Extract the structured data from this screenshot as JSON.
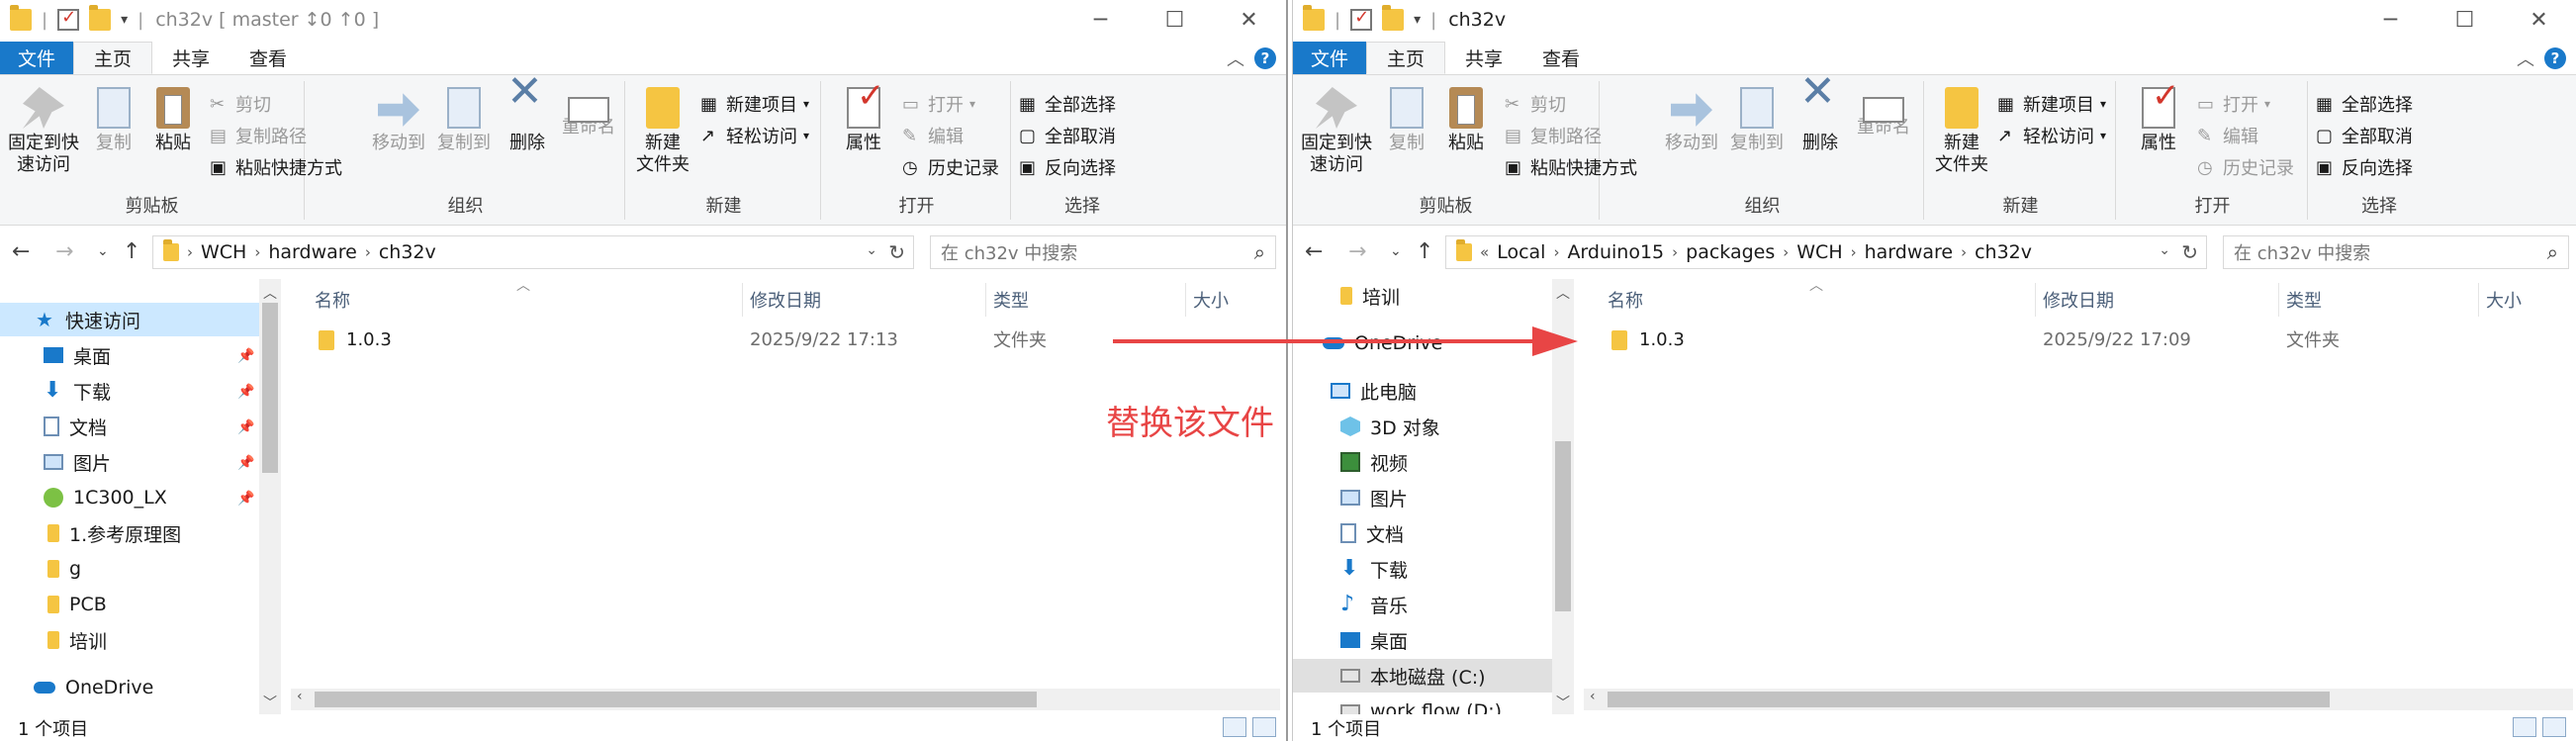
{
  "left": {
    "title": "ch32v [ master ↕0 ↑0 ]",
    "menu": {
      "file": "文件",
      "home": "主页",
      "share": "共享",
      "view": "查看"
    },
    "ribbon": {
      "pin": "固定到快\n速访问",
      "copy": "复制",
      "paste": "粘贴",
      "cut": "剪切",
      "copy_path": "复制路径",
      "paste_shortcut": "粘贴快捷方式",
      "move_to": "移动到",
      "copy_to": "复制到",
      "delete": "删除",
      "rename": "重命名",
      "new_folder": "新建\n文件夹",
      "new_item": "新建项目",
      "easy_access": "轻松访问",
      "properties": "属性",
      "open": "打开",
      "edit": "编辑",
      "history": "历史记录",
      "select_all": "全部选择",
      "select_none": "全部取消",
      "invert": "反向选择",
      "groups": {
        "clipboard": "剪贴板",
        "organize": "组织",
        "new": "新建",
        "open": "打开",
        "select": "选择"
      }
    },
    "path": [
      "WCH",
      "hardware",
      "ch32v"
    ],
    "search_placeholder": "在 ch32v 中搜索",
    "nav": [
      {
        "label": "快速访问",
        "icon": "star-icon"
      },
      {
        "label": "桌面",
        "icon": "desktop-icon"
      },
      {
        "label": "下载",
        "icon": "download-icon"
      },
      {
        "label": "文档",
        "icon": "document-icon"
      },
      {
        "label": "图片",
        "icon": "pictures-icon"
      },
      {
        "label": "1C300_LX",
        "icon": "network-folder-icon"
      },
      {
        "label": "1.参考原理图",
        "icon": "folder-icon"
      },
      {
        "label": "g",
        "icon": "folder-icon"
      },
      {
        "label": "PCB",
        "icon": "folder-icon"
      },
      {
        "label": "培训",
        "icon": "folder-icon"
      },
      {
        "label": "OneDrive",
        "icon": "onedrive-icon"
      }
    ],
    "columns": {
      "name": "名称",
      "date": "修改日期",
      "type": "类型",
      "size": "大小"
    },
    "rows": [
      {
        "name": "1.0.3",
        "date": "2025/9/22 17:13",
        "type": "文件夹"
      }
    ],
    "status": "1 个项目"
  },
  "right": {
    "title": "ch32v",
    "menu": {
      "file": "文件",
      "home": "主页",
      "share": "共享",
      "view": "查看"
    },
    "ribbon": {
      "pin": "固定到快\n速访问",
      "copy": "复制",
      "paste": "粘贴",
      "cut": "剪切",
      "copy_path": "复制路径",
      "paste_shortcut": "粘贴快捷方式",
      "move_to": "移动到",
      "copy_to": "复制到",
      "delete": "删除",
      "rename": "重命名",
      "new_folder": "新建\n文件夹",
      "new_item": "新建项目",
      "easy_access": "轻松访问",
      "properties": "属性",
      "open": "打开",
      "edit": "编辑",
      "history": "历史记录",
      "select_all": "全部选择",
      "select_none": "全部取消",
      "invert": "反向选择",
      "groups": {
        "clipboard": "剪贴板",
        "organize": "组织",
        "new": "新建",
        "open": "打开",
        "select": "选择"
      }
    },
    "path_prefix": "«",
    "path": [
      "Local",
      "Arduino15",
      "packages",
      "WCH",
      "hardware",
      "ch32v"
    ],
    "search_placeholder": "在 ch32v 中搜索",
    "nav": [
      {
        "label": "培训",
        "icon": "folder-icon"
      },
      {
        "label": "OneDrive",
        "icon": "onedrive-icon"
      },
      {
        "label": "此电脑",
        "icon": "pc-icon"
      },
      {
        "label": "3D 对象",
        "icon": "3d-objects-icon"
      },
      {
        "label": "视频",
        "icon": "video-icon"
      },
      {
        "label": "图片",
        "icon": "pictures-icon"
      },
      {
        "label": "文档",
        "icon": "document-icon"
      },
      {
        "label": "下载",
        "icon": "download-icon"
      },
      {
        "label": "音乐",
        "icon": "music-icon"
      },
      {
        "label": "桌面",
        "icon": "desktop-icon"
      },
      {
        "label": "本地磁盘 (C:)",
        "icon": "drive-icon"
      },
      {
        "label": "work flow (D:)",
        "icon": "drive-icon"
      }
    ],
    "columns": {
      "name": "名称",
      "date": "修改日期",
      "type": "类型",
      "size": "大小"
    },
    "rows": [
      {
        "name": "1.0.3",
        "date": "2025/9/22 17:09",
        "type": "文件夹"
      }
    ],
    "status": "1 个项目"
  },
  "annotation": {
    "text": "替换该文件",
    "color": "#e84545"
  },
  "colors": {
    "accent": "#1979ca",
    "folder": "#f5c542",
    "selection": "#cce8ff"
  }
}
